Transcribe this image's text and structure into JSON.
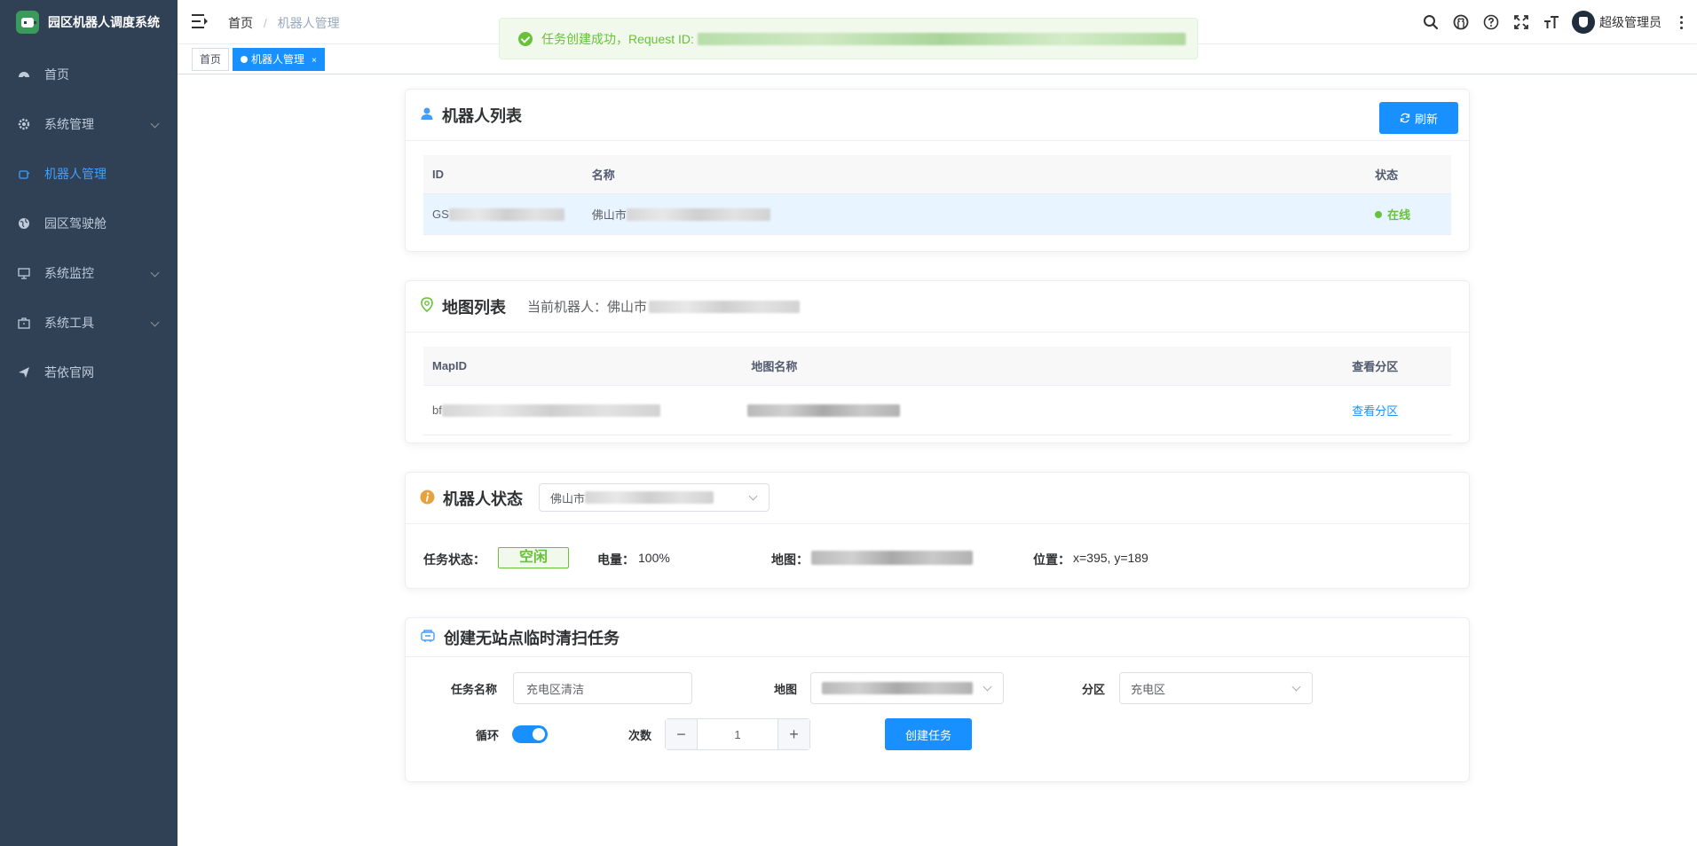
{
  "app": {
    "title": "园区机器人调度系统"
  },
  "sidebar": {
    "items": [
      {
        "label": "首页",
        "icon": "dashboard-icon"
      },
      {
        "label": "系统管理",
        "icon": "gear-icon"
      },
      {
        "label": "机器人管理",
        "icon": "robot-icon",
        "active": true
      },
      {
        "label": "园区驾驶舱",
        "icon": "globe-icon"
      },
      {
        "label": "系统监控",
        "icon": "monitor-icon"
      },
      {
        "label": "系统工具",
        "icon": "toolbox-icon"
      },
      {
        "label": "若依官网",
        "icon": "send-icon"
      }
    ]
  },
  "navbar": {
    "breadcrumb": {
      "home": "首页",
      "sep": "/",
      "current": "机器人管理"
    },
    "username": "超级管理员"
  },
  "tags": {
    "home": "首页",
    "current": "机器人管理",
    "close": "×"
  },
  "toast": {
    "message": "任务创建成功，Request ID:"
  },
  "robot_list": {
    "title": "机器人列表",
    "refresh": "刷新",
    "headers": {
      "id": "ID",
      "name": "名称",
      "status": "状态"
    },
    "row": {
      "id_prefix": "GS",
      "name_prefix": "佛山市",
      "status": "在线"
    }
  },
  "map_list": {
    "title": "地图列表",
    "current_label": "当前机器人：",
    "current_prefix": "佛山市",
    "headers": {
      "map_id": "MapID",
      "map_name": "地图名称",
      "zones": "查看分区"
    },
    "row": {
      "id_prefix": "bf",
      "zones_link": "查看分区"
    }
  },
  "robot_status": {
    "title": "机器人状态",
    "selected": "佛山市",
    "task_label": "任务状态：",
    "task_value": "空闲",
    "battery_label": "电量：",
    "battery_value": "100%",
    "map_label": "地图：",
    "position_label": "位置：",
    "position_value": "x=395, y=189"
  },
  "create_task": {
    "title": "创建无站点临时清扫任务",
    "name_label": "任务名称",
    "name_value": "充电区清洁",
    "map_label": "地图",
    "zone_label": "分区",
    "zone_value": "充电区",
    "loop_label": "循环",
    "loop_on": true,
    "count_label": "次数",
    "count_value": "1",
    "minus": "−",
    "plus": "+",
    "submit": "创建任务"
  },
  "colors": {
    "primary": "#1890ff",
    "success": "#67c23a",
    "sidebar_bg": "#304156",
    "warning": "#e6a23c"
  }
}
